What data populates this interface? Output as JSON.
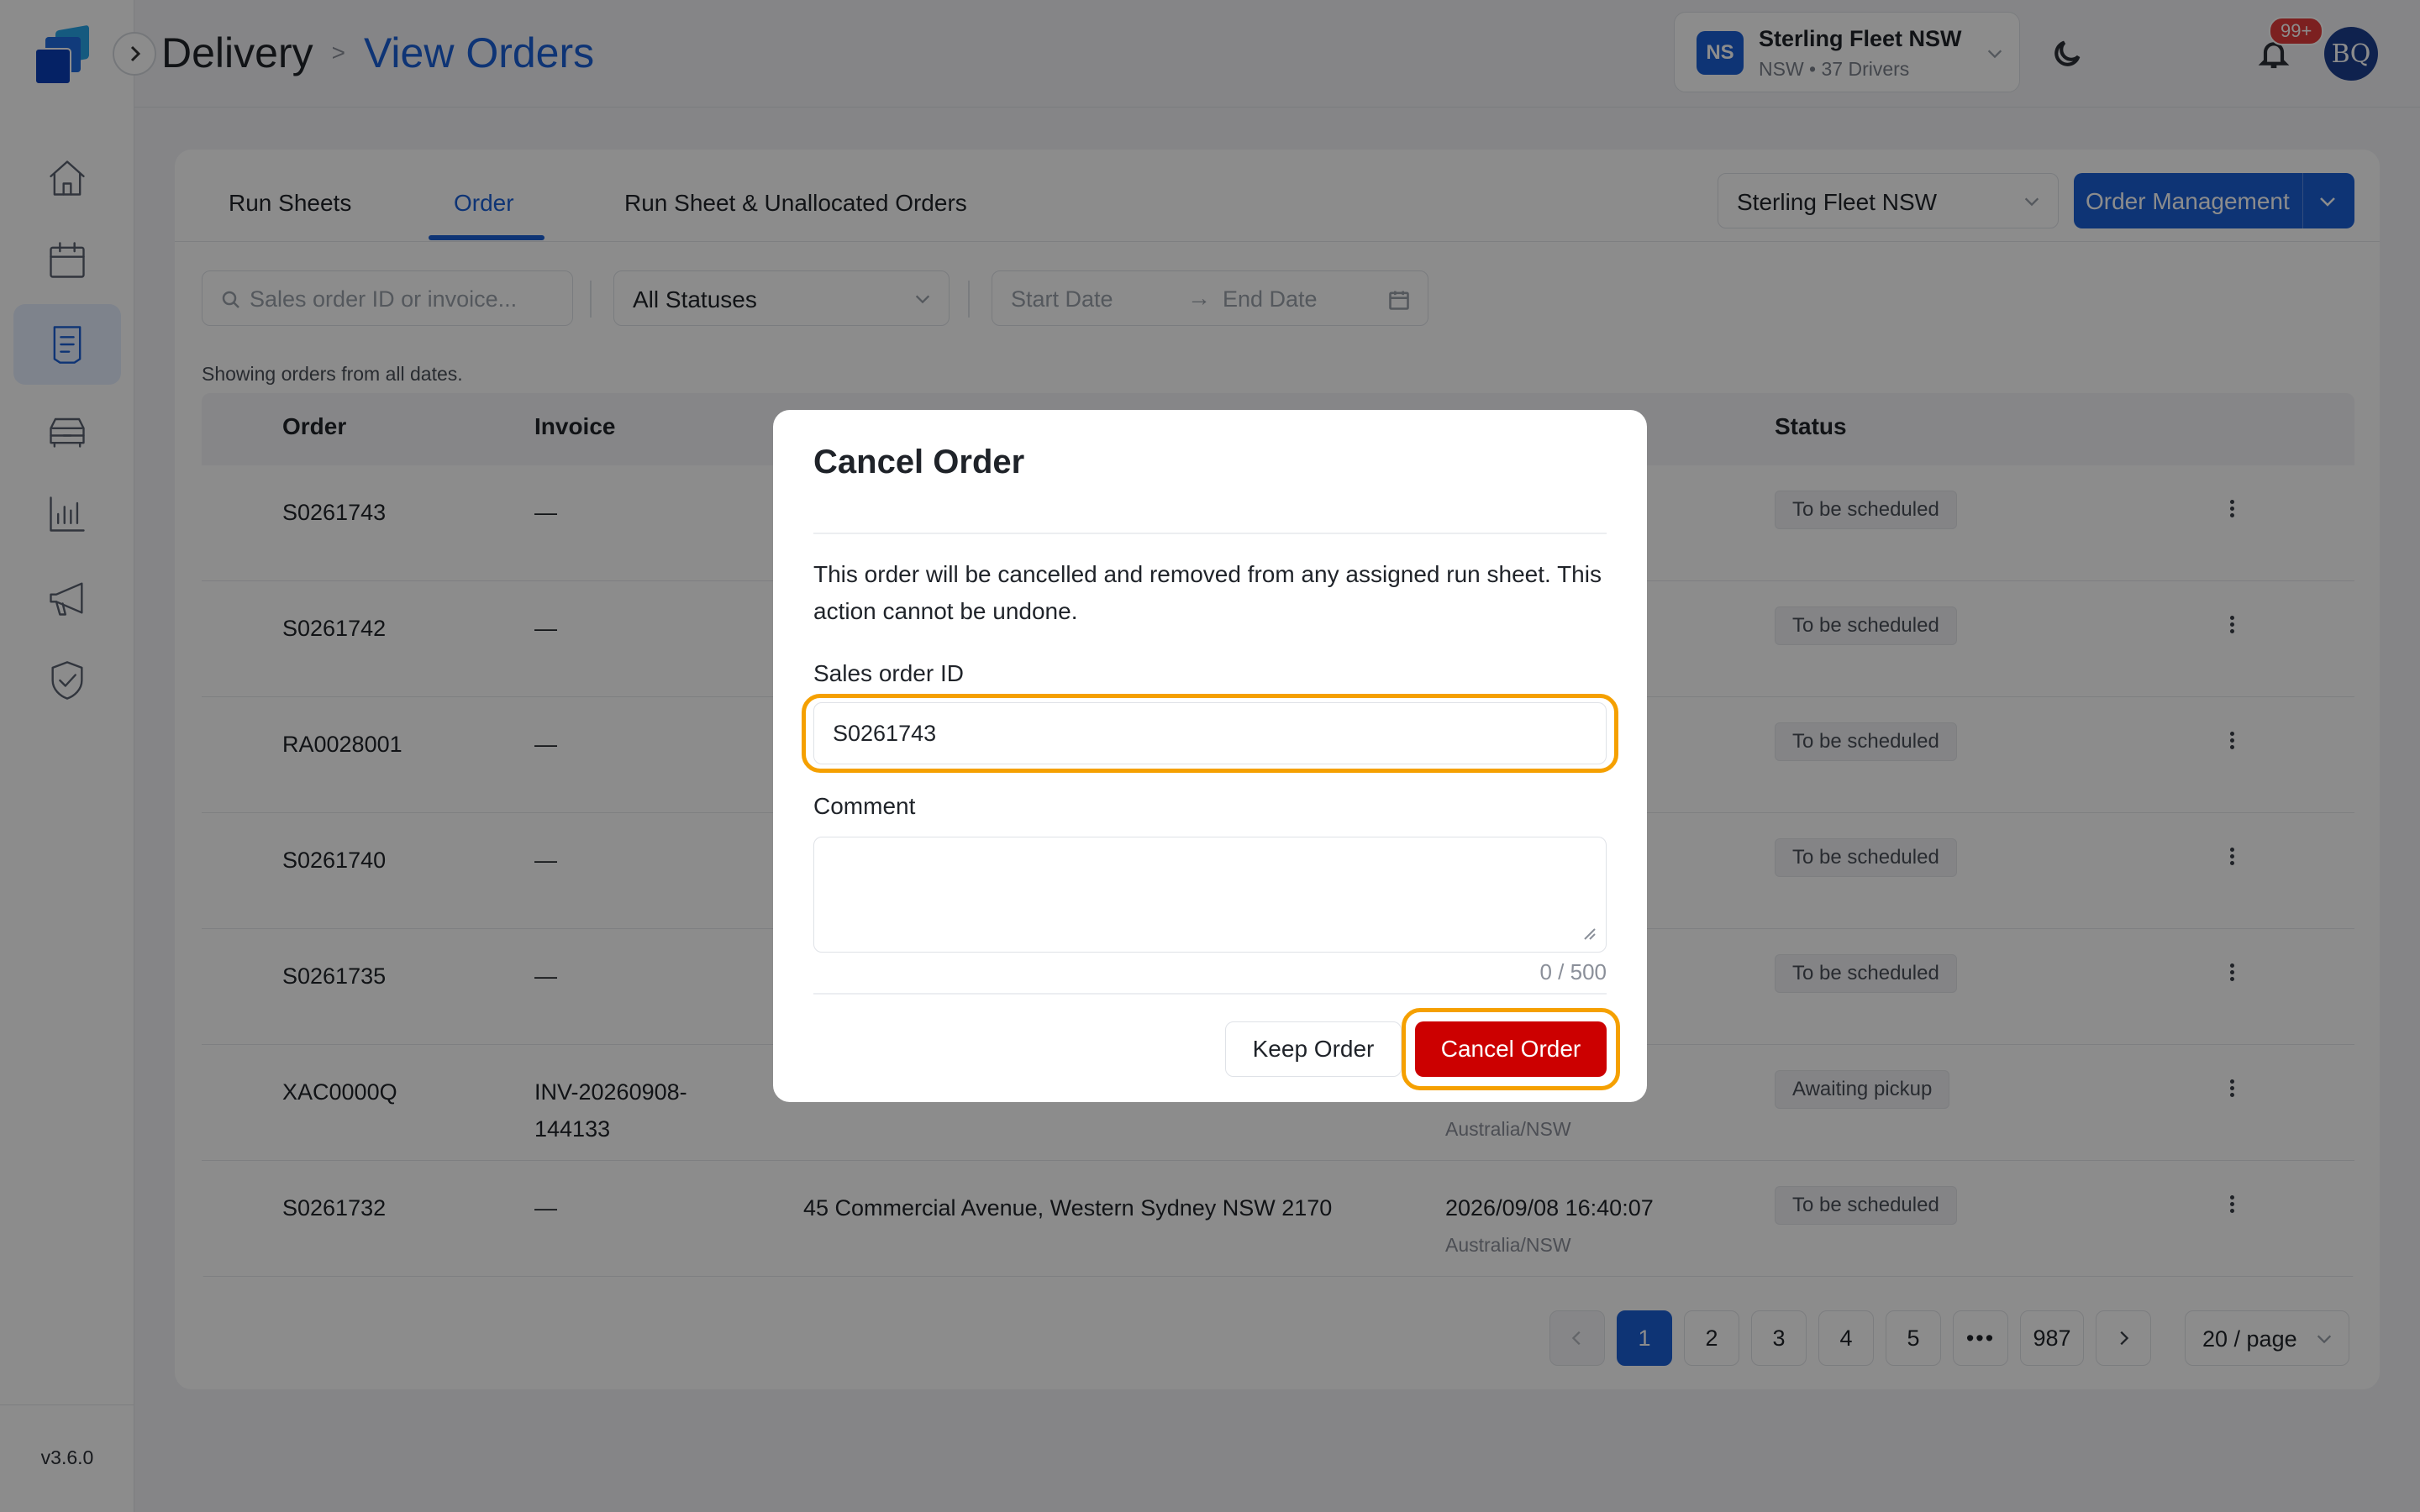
{
  "app": {
    "version": "v3.6.0"
  },
  "breadcrumb": {
    "root": "Delivery",
    "separator": ">",
    "current": "View Orders"
  },
  "org": {
    "initials": "NS",
    "name": "Sterling Fleet NSW",
    "sub": "NSW • 37 Drivers"
  },
  "notifications": {
    "count": "99+"
  },
  "user": {
    "initials": "BQ"
  },
  "tabs": [
    {
      "label": "Run Sheets"
    },
    {
      "label": "Order"
    },
    {
      "label": "Run Sheet & Unallocated Orders"
    }
  ],
  "fleet_select": {
    "value": "Sterling Fleet NSW"
  },
  "management_button": {
    "label": "Order Management"
  },
  "filters": {
    "search_placeholder": "Sales order ID or invoice...",
    "status_value": "All Statuses",
    "start_date_placeholder": "Start Date",
    "range_arrow": "→",
    "end_date_placeholder": "End Date"
  },
  "showing_text": "Showing orders from all dates.",
  "table": {
    "headers": {
      "order": "Order",
      "invoice": "Invoice",
      "status": "Status"
    },
    "rows": [
      {
        "order": "S0261743",
        "invoice": "—",
        "address": "",
        "date": "",
        "tz": "",
        "status": "To be scheduled"
      },
      {
        "order": "S0261742",
        "invoice": "—",
        "address": "",
        "date": "",
        "tz": "",
        "status": "To be scheduled"
      },
      {
        "order": "RA0028001",
        "invoice": "—",
        "address": "",
        "date": "",
        "tz": "",
        "status": "To be scheduled"
      },
      {
        "order": "S0261740",
        "invoice": "—",
        "address": "",
        "date": "",
        "tz": "",
        "status": "To be scheduled"
      },
      {
        "order": "S0261735",
        "invoice": "—",
        "address": "",
        "date": "",
        "tz": "",
        "status": "To be scheduled"
      },
      {
        "order": "XAC0000Q",
        "invoice": "INV-20260908-\n144133",
        "address": "",
        "date": "",
        "tz": "Australia/NSW",
        "status": "Awaiting pickup"
      },
      {
        "order": "S0261732",
        "invoice": "—",
        "address": "45 Commercial Avenue, Western Sydney NSW 2170",
        "date": "2026/09/08 16:40:07",
        "tz": "Australia/NSW",
        "status": "To be scheduled"
      }
    ]
  },
  "pagination": {
    "pages": [
      "1",
      "2",
      "3",
      "4",
      "5"
    ],
    "ellipsis": "•••",
    "last": "987",
    "current": "1",
    "page_size": "20 / page"
  },
  "modal": {
    "title": "Cancel Order",
    "description": "This order will be cancelled and removed from any assigned run sheet. This action cannot be undone.",
    "sales_order_label": "Sales order ID",
    "sales_order_value": "S0261743",
    "comment_label": "Comment",
    "comment_value": "",
    "char_count": "0 / 500",
    "keep_label": "Keep Order",
    "cancel_label": "Cancel Order"
  },
  "colors": {
    "primary": "#1a5fd6",
    "danger": "#cc0000",
    "focus_ring": "#f5a000",
    "badge": "#e23b3b"
  }
}
